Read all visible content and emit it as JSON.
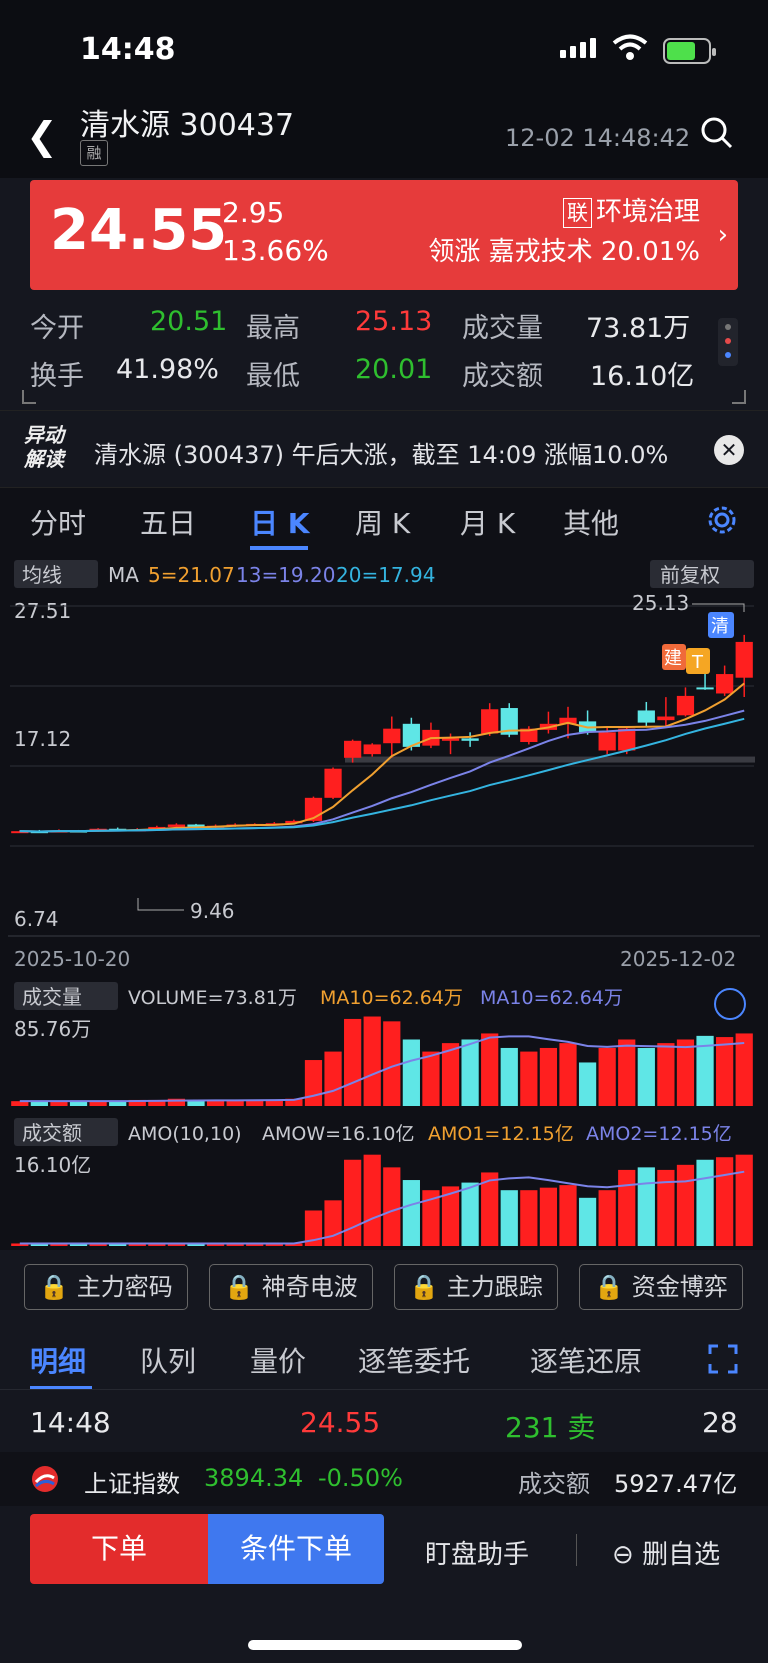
{
  "status": {
    "time": "14:48"
  },
  "header": {
    "title": "清水源 300437",
    "badge": "融",
    "datetime": "12-02 14:48:42"
  },
  "quote": {
    "price": "24.55",
    "change": "2.95",
    "change_pct": "13.66%",
    "sector_badge": "联",
    "sector": "环境治理",
    "leader": "领涨 嘉戎技术 20.01%",
    "colors": {
      "up": "#e63b3b",
      "down": "#2fbf2f",
      "accent": "#4b86ff"
    }
  },
  "stats": {
    "open_label": "今开",
    "open": "20.51",
    "high_label": "最高",
    "high": "25.13",
    "volume_label": "成交量",
    "volume": "73.81万",
    "turnover_label": "换手",
    "turnover": "41.98%",
    "low_label": "最低",
    "low": "20.01",
    "amount_label": "成交额",
    "amount": "16.10亿"
  },
  "news": {
    "badge_line1": "异动",
    "badge_line2": "解读",
    "text": "清水源 (300437) 午后大涨，截至 14:09 涨幅10.0%"
  },
  "tabs": {
    "t1": "分时",
    "t2": "五日",
    "t3": "日 K",
    "t4": "周 K",
    "t5": "月 K",
    "t6": "其他"
  },
  "kline": {
    "ma_dropdown": "均线",
    "ma_label": "MA",
    "ma5": "5=21.07",
    "ma13": "13=19.20",
    "ma20": "20=17.94",
    "adjust": "前复权",
    "y_top": "27.51",
    "y_mid": "17.12",
    "y_bot": "6.74",
    "high_mark": "25.13",
    "low_mark": "9.46",
    "marker_jian": "建",
    "marker_t": "T",
    "marker_qing": "清",
    "date_start": "2025-10-20",
    "date_end": "2025-12-02",
    "vol_dropdown": "成交量",
    "vol_text": "VOLUME=73.81万",
    "vol_ma10a": "MA10=62.64万",
    "vol_ma10b": "MA10=62.64万",
    "vol_max": "85.76万",
    "amo_dropdown": "成交额",
    "amo_text": "AMO(10,10)",
    "amow": "AMOW=16.10亿",
    "amo1": "AMO1=12.15亿",
    "amo2": "AMO2=12.15亿",
    "amo_max": "16.10亿"
  },
  "chart_data": {
    "type": "candlestick",
    "x_start": "2025-10-20",
    "x_end": "2025-12-02",
    "ylim": [
      6.74,
      27.51
    ],
    "ohlc": [
      [
        8.9,
        9.0,
        8.8,
        8.95
      ],
      [
        8.95,
        9.05,
        8.85,
        8.9
      ],
      [
        8.9,
        9.1,
        8.85,
        9.0
      ],
      [
        9.0,
        9.05,
        8.9,
        8.95
      ],
      [
        8.95,
        9.2,
        8.9,
        9.15
      ],
      [
        9.15,
        9.25,
        9.0,
        9.05
      ],
      [
        9.05,
        9.2,
        9.0,
        9.1
      ],
      [
        9.1,
        9.4,
        9.05,
        9.3
      ],
      [
        9.3,
        9.6,
        9.2,
        9.5
      ],
      [
        9.5,
        9.55,
        9.2,
        9.3
      ],
      [
        9.3,
        9.5,
        9.2,
        9.4
      ],
      [
        9.4,
        9.6,
        9.3,
        9.5
      ],
      [
        9.5,
        9.6,
        9.4,
        9.55
      ],
      [
        9.55,
        9.7,
        9.45,
        9.6
      ],
      [
        9.6,
        9.9,
        9.55,
        9.8
      ],
      [
        9.8,
        11.8,
        9.7,
        11.7
      ],
      [
        11.7,
        14.2,
        11.6,
        14.1
      ],
      [
        15.0,
        16.5,
        14.6,
        16.4
      ],
      [
        15.3,
        16.2,
        15.1,
        16.1
      ],
      [
        16.2,
        18.4,
        15.0,
        17.4
      ],
      [
        17.8,
        18.3,
        15.6,
        15.9
      ],
      [
        16.0,
        17.9,
        15.8,
        17.3
      ],
      [
        16.4,
        17.0,
        15.3,
        16.6
      ],
      [
        16.6,
        17.1,
        15.9,
        16.4
      ],
      [
        17.0,
        19.5,
        16.8,
        19.0
      ],
      [
        19.1,
        19.5,
        16.7,
        16.9
      ],
      [
        16.3,
        17.6,
        16.1,
        17.4
      ],
      [
        17.3,
        18.8,
        17.0,
        17.8
      ],
      [
        17.8,
        19.2,
        16.6,
        18.3
      ],
      [
        18.0,
        18.9,
        16.9,
        17.1
      ],
      [
        15.6,
        17.5,
        15.3,
        17.1
      ],
      [
        15.6,
        17.6,
        15.3,
        17.4
      ],
      [
        18.9,
        19.6,
        17.5,
        17.9
      ],
      [
        18.1,
        20.0,
        17.5,
        18.4
      ],
      [
        18.5,
        20.8,
        18.4,
        20.1
      ],
      [
        20.8,
        22.8,
        20.6,
        20.7
      ],
      [
        20.3,
        22.6,
        20.1,
        21.9
      ],
      [
        21.6,
        25.13,
        20.01,
        24.55
      ]
    ],
    "ma5_last": 21.07,
    "ma13_last": 19.2,
    "ma20_last": 17.94,
    "volume": [
      4,
      4,
      4,
      4,
      4,
      4,
      5,
      5,
      6,
      5,
      5,
      5,
      5,
      5,
      6,
      38,
      45,
      72,
      74,
      70,
      55,
      45,
      52,
      55,
      60,
      48,
      45,
      48,
      52,
      36,
      48,
      55,
      48,
      52,
      55,
      58,
      57,
      60,
      62
    ],
    "volume_max": 85.76,
    "amount": [
      2,
      2,
      2,
      2,
      2,
      2,
      2,
      2,
      2,
      2,
      2,
      2,
      2,
      2,
      2,
      28,
      36,
      68,
      72,
      62,
      52,
      44,
      47,
      50,
      58,
      44,
      44,
      46,
      48,
      38,
      44,
      60,
      62,
      60,
      64,
      68,
      70,
      72,
      80
    ],
    "amount_max": 16.1
  },
  "feature_buttons": {
    "b1": "主力密码",
    "b2": "神奇电波",
    "b3": "主力跟踪",
    "b4": "资金博弈"
  },
  "detail_tabs": {
    "t1": "明细",
    "t2": "队列",
    "t3": "量价",
    "t4": "逐笔委托",
    "t5": "逐笔还原"
  },
  "deal": {
    "time": "14:48",
    "price": "24.55",
    "vol": "231 卖",
    "count": "28"
  },
  "index": {
    "name": "上证指数",
    "value": "3894.34",
    "pct": "-0.50%",
    "amount_label": "成交额",
    "amount": "5927.47亿"
  },
  "bottom": {
    "order": "下单",
    "cond_order": "条件下单",
    "helper": "盯盘助手",
    "delete": "删自选"
  }
}
